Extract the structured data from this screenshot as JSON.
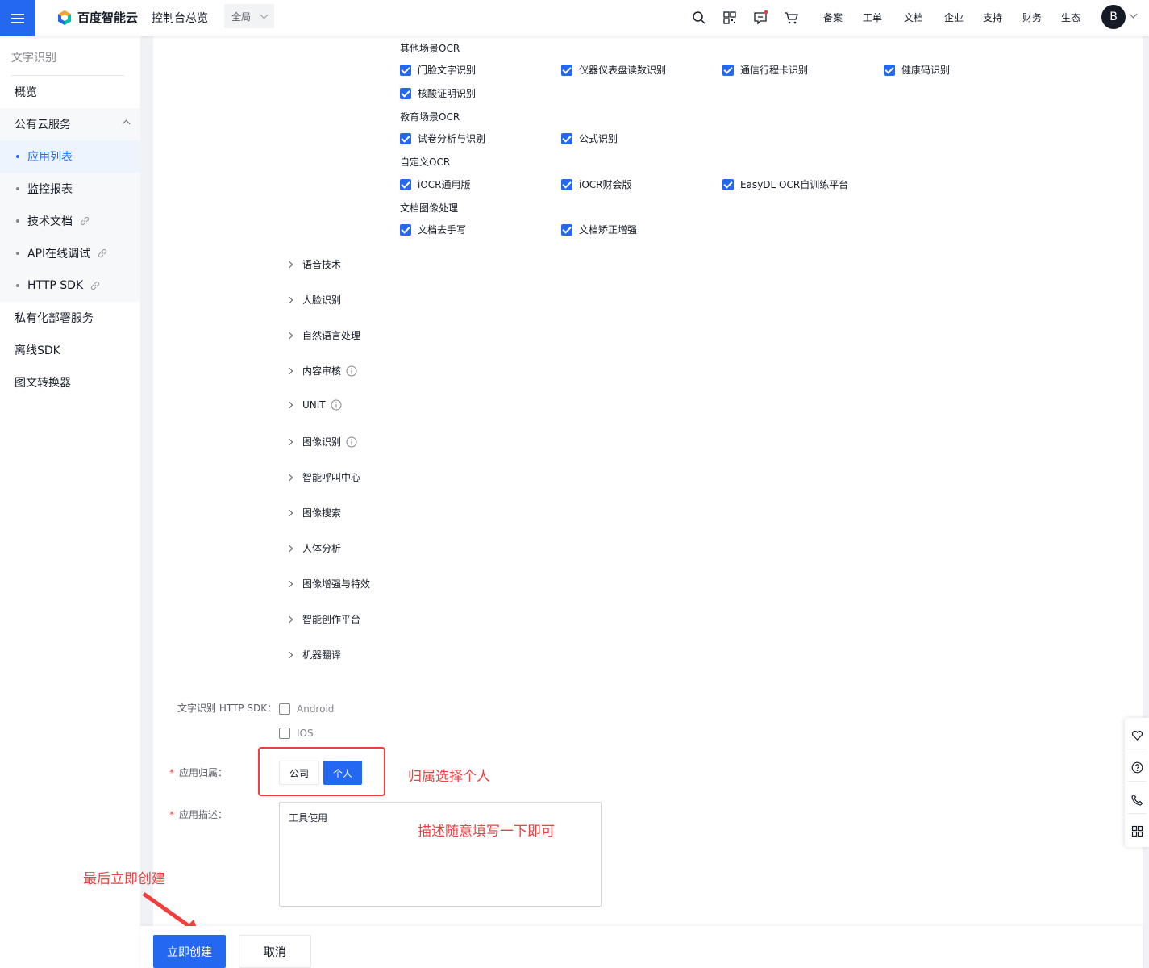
{
  "header": {
    "brand": "百度智能云",
    "console": "控制台总览",
    "region": "全局",
    "nav": [
      "备案",
      "工单",
      "文档",
      "企业",
      "支持",
      "财务",
      "生态"
    ],
    "avatar": "B",
    "icons": [
      "search-icon",
      "qrcode-icon",
      "message-icon",
      "cart-icon"
    ]
  },
  "sidebar": {
    "title": "文字识别",
    "items": [
      {
        "label": "概览"
      },
      {
        "label": "公有云服务"
      },
      {
        "label": "应用列表"
      },
      {
        "label": "监控报表"
      },
      {
        "label": "技术文档"
      },
      {
        "label": "API在线调试"
      },
      {
        "label": "HTTP SDK"
      },
      {
        "label": "私有化部署服务"
      },
      {
        "label": "离线SDK"
      },
      {
        "label": "图文转换器"
      }
    ]
  },
  "ocr": {
    "groups": [
      {
        "title": "其他场景OCR",
        "items": [
          "门脸文字识别",
          "仪器仪表盘读数识别",
          "通信行程卡识别",
          "健康码识别",
          "核酸证明识别"
        ]
      },
      {
        "title": "教育场景OCR",
        "items": [
          "试卷分析与识别",
          "公式识别"
        ]
      },
      {
        "title": "自定义OCR",
        "items": [
          "iOCR通用版",
          "iOCR财会版",
          "EasyDL OCR自训练平台"
        ]
      },
      {
        "title": "文档图像处理",
        "items": [
          "文档去手写",
          "文档矫正增强"
        ]
      }
    ]
  },
  "collapsed": [
    "语音技术",
    "人脸识别",
    "自然语言处理",
    "内容审核",
    "UNIT",
    "图像识别",
    "智能呼叫中心",
    "图像搜索",
    "人体分析",
    "图像增强与特效",
    "智能创作平台",
    "机器翻译"
  ],
  "form": {
    "sdk_label": "文字识别 HTTP SDK：",
    "sdk_options": [
      "Android",
      "IOS"
    ],
    "owner_label": "应用归属：",
    "owner_options": [
      "公司",
      "个人"
    ],
    "desc_label": "应用描述：",
    "desc_value": "工具使用",
    "required_mark": "*"
  },
  "annotations": {
    "owner_note": "归属选择个人",
    "desc_note": "描述随意填写一下即可",
    "create_note": "最后立即创建"
  },
  "footer": {
    "create": "立即创建",
    "cancel": "取消"
  },
  "colors": {
    "primary": "#2468f2",
    "annotation": "#f33e3e"
  }
}
